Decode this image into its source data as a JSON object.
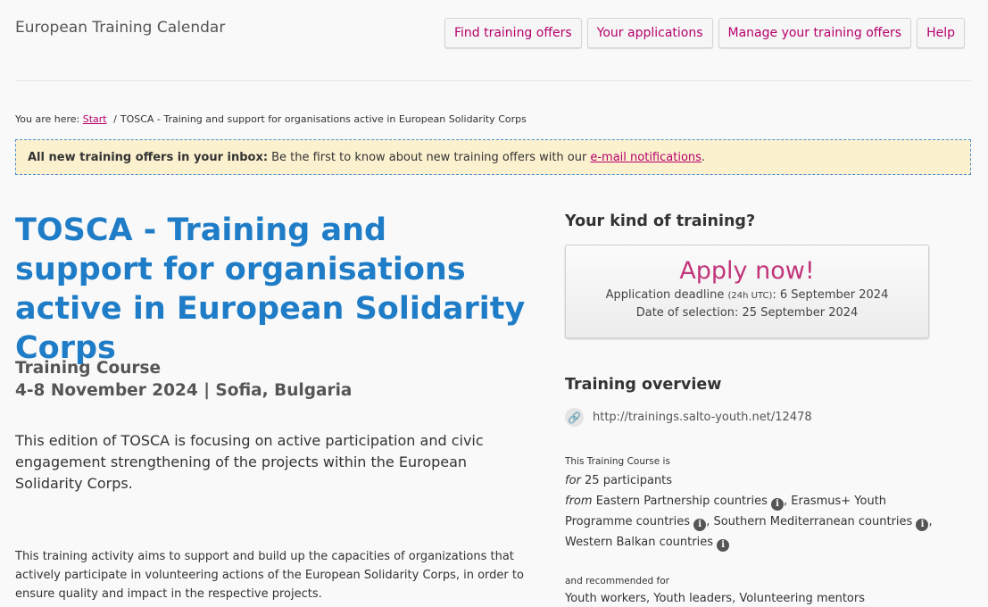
{
  "header": {
    "site_title": "European Training Calendar",
    "nav": {
      "find": "Find training offers",
      "applications": "Your applications",
      "manage": "Manage your training offers",
      "help": "Help"
    }
  },
  "breadcrumb": {
    "prefix": "You are here:",
    "start": "Start",
    "separator": "/",
    "current": "TOSCA - Training and support for organisations active in European Solidarity Corps"
  },
  "notice": {
    "bold": "All new training offers in your inbox:",
    "text": "Be the first to know about new training offers with our",
    "link": "e-mail notifications",
    "end": "."
  },
  "main": {
    "title": "TOSCA - Training and support for organisations active in European Solidarity Corps",
    "type": "Training Course",
    "date_place": "4-8 November 2024 | Sofia, Bulgaria",
    "lead": "This edition of TOSCA is focusing on active participation and civic engagement strengthening of the projects within the European Solidarity Corps.",
    "body": "This training activity aims to support and build up the capacities of organizations that actively participate in volunteering actions of the European Solidarity Corps, in order to ensure quality and impact in the respective projects."
  },
  "sidebar": {
    "kind_heading": "Your kind of training?",
    "apply": {
      "title": "Apply now!",
      "deadline_label": "Application deadline",
      "deadline_tz": "(24h UTC)",
      "deadline_value": ": 6 September 2024",
      "selection": "Date of selection: 25 September 2024"
    },
    "overview_heading": "Training overview",
    "url": "http://trainings.salto-youth.net/12478",
    "intro": "This Training Course is",
    "for_word": "for",
    "participants": "25 participants",
    "from_word": "from",
    "countries": [
      "Eastern Partnership countries",
      ", Erasmus+ Youth Programme countries",
      ", Southern Mediterranean countries",
      ", Western Balkan countries"
    ],
    "recommended": "and recommended for",
    "target_groups": "Youth workers, Youth leaders, Volunteering mentors"
  },
  "icons": {
    "info_glyph": "i",
    "link_glyph": "🔗"
  },
  "colors": {
    "accent_magenta": "#b5006b",
    "title_blue": "#1f7dc8",
    "notice_bg": "#fcf1cf",
    "notice_border": "#4a8fd0"
  }
}
